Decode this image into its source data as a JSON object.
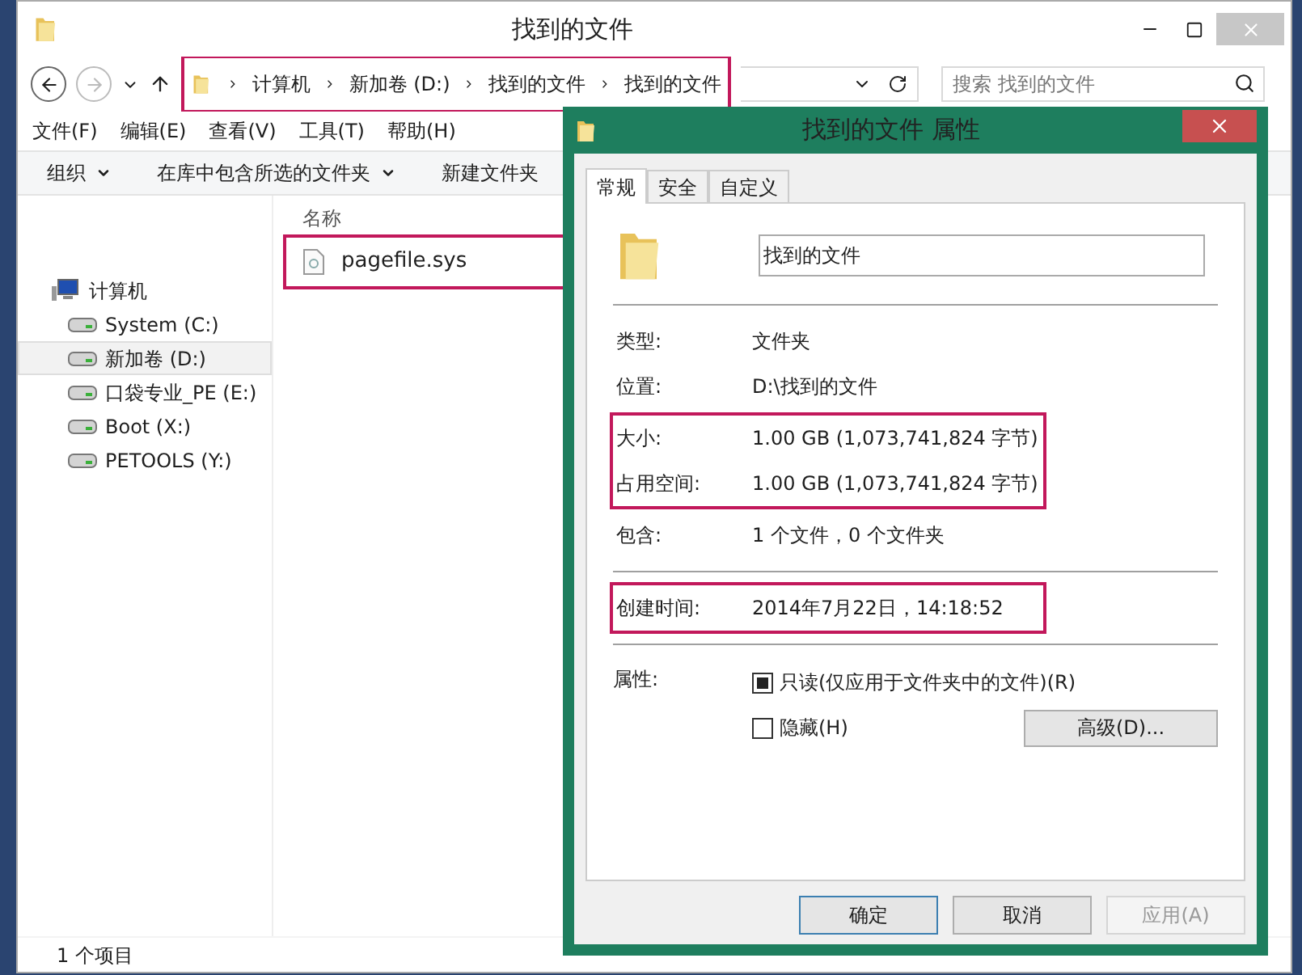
{
  "explorer": {
    "title": "找到的文件",
    "breadcrumb": {
      "highlighted": true,
      "items": [
        "计算机",
        "新加卷 (D:)",
        "找到的文件",
        "找到的文件"
      ]
    },
    "search": {
      "placeholder": "搜索 找到的文件"
    },
    "menu": [
      "文件(F)",
      "编辑(E)",
      "查看(V)",
      "工具(T)",
      "帮助(H)"
    ],
    "toolbar": [
      {
        "label": "组织",
        "dropdown": true
      },
      {
        "label": "在库中包含所选的文件夹",
        "dropdown": true
      },
      {
        "label": "新建文件夹",
        "dropdown": false
      }
    ],
    "nav": [
      {
        "label": "计算机",
        "kind": "computer",
        "selected": false,
        "children": [
          {
            "label": "System (C:)",
            "kind": "drive",
            "selected": false
          },
          {
            "label": "新加卷 (D:)",
            "kind": "drive",
            "selected": true
          },
          {
            "label": "口袋专业_PE (E:)",
            "kind": "drive",
            "selected": false
          },
          {
            "label": "Boot (X:)",
            "kind": "drive",
            "selected": false
          },
          {
            "label": "PETOOLS (Y:)",
            "kind": "drive",
            "selected": false
          }
        ]
      }
    ],
    "column": "名称",
    "files": [
      {
        "name": "pagefile.sys",
        "highlighted": true
      }
    ],
    "status": "1 个项目"
  },
  "dialog": {
    "title": "找到的文件 属性",
    "tabs": [
      {
        "label": "常规",
        "selected": true
      },
      {
        "label": "安全",
        "selected": false
      },
      {
        "label": "自定义",
        "selected": false
      }
    ],
    "name": "找到的文件",
    "sections": [
      [
        {
          "highlighted": false,
          "rows": [
            {
              "label": "类型:",
              "value": "文件夹"
            },
            {
              "label": "位置:",
              "value": "D:\\找到的文件"
            }
          ]
        },
        {
          "highlighted": true,
          "rows": [
            {
              "label": "大小:",
              "value": "1.00 GB (1,073,741,824 字节)"
            },
            {
              "label": "占用空间:",
              "value": "1.00 GB (1,073,741,824 字节)"
            }
          ]
        },
        {
          "highlighted": false,
          "rows": [
            {
              "label": "包含:",
              "value": "1 个文件，0 个文件夹"
            }
          ]
        }
      ],
      [
        {
          "highlighted": true,
          "rows": [
            {
              "label": "创建时间:",
              "value": "2014年7月22日，14:18:52"
            }
          ]
        }
      ]
    ],
    "attributes": {
      "label": "属性:",
      "items": [
        {
          "label": "只读(仅应用于文件夹中的文件)(R)",
          "indeterminate": true
        },
        {
          "label": "隐藏(H)",
          "indeterminate": false
        }
      ],
      "advanced": "高级(D)..."
    },
    "buttons": [
      {
        "label": "确定",
        "default": true,
        "disabled": false
      },
      {
        "label": "取消",
        "default": false,
        "disabled": false
      },
      {
        "label": "应用(A)",
        "default": false,
        "disabled": true
      }
    ]
  }
}
